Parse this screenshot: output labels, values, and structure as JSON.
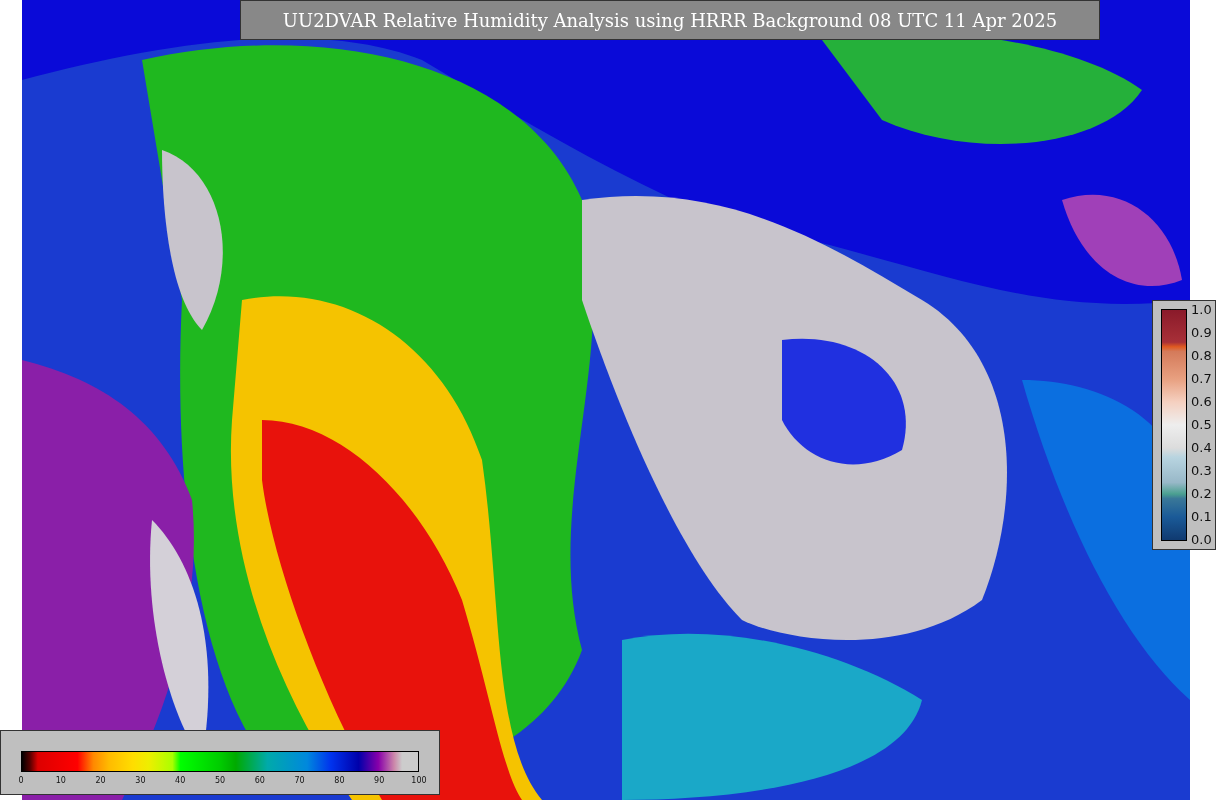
{
  "title": "UU2DVAR Relative Humidity Analysis using HRRR Background 08 UTC 11 Apr 2025",
  "increment_legend": {
    "ticks": [
      "1.0",
      "0.9",
      "0.8",
      "0.7",
      "0.6",
      "0.5",
      "0.4",
      "0.3",
      "0.2",
      "0.1",
      "0.0"
    ]
  },
  "humidity_legend": {
    "ticks": [
      "0",
      "10",
      "20",
      "30",
      "40",
      "50",
      "60",
      "70",
      "80",
      "90",
      "100"
    ]
  }
}
